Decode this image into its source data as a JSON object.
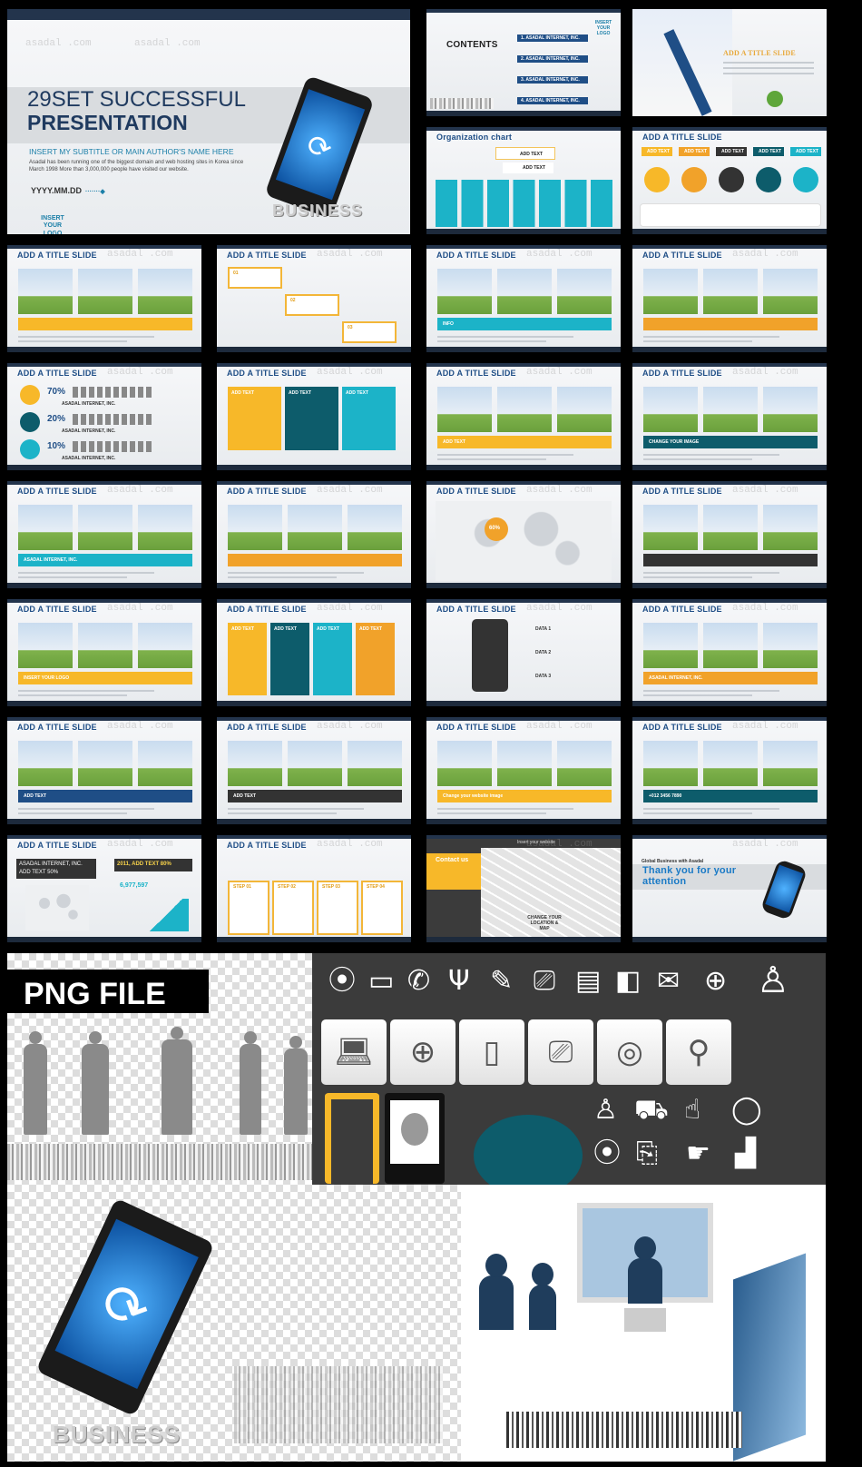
{
  "watermark": "asadal .com",
  "cover": {
    "title_line1": "29SET SUCCESSFUL",
    "title_line2": "PRESENTATION",
    "subtitle": "INSERT MY SUBTITLE OR MAIN AUTHOR'S NAME HERE",
    "description": "Asadal has been running one of the biggest domain and web hosting sites in Korea since March 1998 More than 3,000,000 people have visited our website.",
    "date": "YYYY.MM.DD",
    "logo": "INSERT YOUR LOGO",
    "business_text": "BUSINESS"
  },
  "slides": [
    {
      "title": "CONTENTS",
      "items": [
        "1. ASADAL INTERNET, INC.",
        "2. ASADAL INTERNET, INC.",
        "3. ASADAL INTERNET, INC.",
        "4. ASADAL INTERNET, INC."
      ],
      "logo": "INSERT YOUR LOGO"
    },
    {
      "title": "ADD A TITLE SLIDE"
    },
    {
      "title": "Organization chart",
      "box": "ADD TEXT"
    },
    {
      "title": "ADD A TITLE SLIDE",
      "labels": [
        "ADD TEXT",
        "ADD TEXT",
        "ADD TEXT",
        "ADD TEXT",
        "ADD TEXT"
      ]
    },
    {
      "title": "ADD A TITLE SLIDE"
    },
    {
      "title": "ADD A TITLE SLIDE",
      "steps": [
        "01",
        "02",
        "03"
      ]
    },
    {
      "title": "ADD A TITLE SLIDE",
      "info": "INFO"
    },
    {
      "title": "ADD A TITLE SLIDE"
    },
    {
      "title": "ADD A TITLE SLIDE",
      "percents": [
        "70%",
        "20%",
        "10%"
      ],
      "company": "ASADAL INTERNET, INC."
    },
    {
      "title": "ADD A TITLE SLIDE",
      "labels": [
        "ADD TEXT",
        "ADD TEXT",
        "ADD TEXT"
      ]
    },
    {
      "title": "ADD A TITLE SLIDE",
      "heading": "ADD TEXT"
    },
    {
      "title": "ADD A TITLE SLIDE",
      "caption": "CHANGE YOUR IMAGE"
    },
    {
      "title": "ADD A TITLE SLIDE",
      "company": "ASADAL INTERNET, INC."
    },
    {
      "title": "ADD A TITLE SLIDE"
    },
    {
      "title": "ADD A TITLE SLIDE",
      "value": "60%"
    },
    {
      "title": "ADD A TITLE SLIDE"
    },
    {
      "title": "ADD A TITLE SLIDE",
      "phone_text": "INSERT YOUR LOGO"
    },
    {
      "title": "ADD A TITLE SLIDE",
      "labels": [
        "ADD TEXT",
        "ADD TEXT",
        "ADD TEXT",
        "ADD TEXT"
      ]
    },
    {
      "title": "ADD A TITLE SLIDE",
      "data": [
        "DATA 1",
        "DATA 2",
        "DATA 3"
      ]
    },
    {
      "title": "ADD A TITLE SLIDE",
      "banner": "ASADAL INTERNET, INC."
    },
    {
      "title": "ADD A TITLE SLIDE",
      "heading": "ADD TEXT"
    },
    {
      "title": "ADD A TITLE SLIDE",
      "heading": "ADD TEXT"
    },
    {
      "title": "ADD A TITLE SLIDE",
      "caption": "Change your website image"
    },
    {
      "title": "ADD A TITLE SLIDE",
      "phone": "+012 3456 7890"
    },
    {
      "title": "ADD A TITLE SLIDE",
      "headline1": "ASADAL INTERNET, INC.",
      "headline2": "ADD TEXT 50%",
      "headline3": "2011, ADD TEXT 80%",
      "number": "6,977,597"
    },
    {
      "title": "ADD A TITLE SLIDE",
      "steps": [
        "STEP 01",
        "STEP 02",
        "STEP 03",
        "STEP 04"
      ]
    },
    {
      "title": "Contact us",
      "website": "Insert your website",
      "map_label": "CHANGE YOUR LOCATION & MAP"
    },
    {
      "title": "Thank you for your attention",
      "kicker": "Global Business with Asadal"
    }
  ],
  "png_section": {
    "label": "PNG FILE",
    "icons": [
      "map-pin",
      "monitor",
      "phone",
      "sprout",
      "pushpin",
      "tv",
      "document",
      "blocks",
      "envelope",
      "globe",
      "person"
    ],
    "tiles": [
      "laptop",
      "globe-mouse",
      "mobile",
      "tv",
      "radio",
      "satellite"
    ],
    "icons_row3": [
      "user",
      "cart",
      "thumbs-up",
      "speech-bubble"
    ],
    "icons_row4": [
      "location",
      "exit",
      "hand-pointer",
      "bar-chart"
    ],
    "accent_colors": {
      "orange": "#f7b829",
      "teal": "#0d5c6b",
      "navy": "#1f3d5c"
    }
  }
}
